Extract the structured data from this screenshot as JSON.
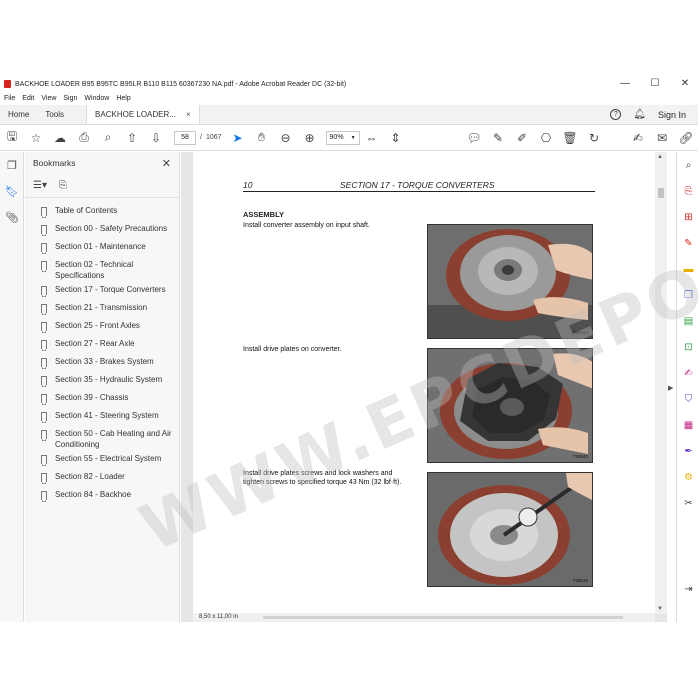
{
  "window": {
    "title": "BACKHOE LOADER B95 B95TC B95LR B110 B115 60367230 NA.pdf - Adobe Acrobat Reader DC (32-bit)",
    "controls": [
      "—",
      "☐",
      "✕"
    ]
  },
  "menubar": [
    "File",
    "Edit",
    "View",
    "Sign",
    "Window",
    "Help"
  ],
  "tabs": {
    "home": "Home",
    "tools": "Tools",
    "document": "BACKHOE LOADER...",
    "close": "×",
    "help": "?",
    "sign_in": "Sign In"
  },
  "toolbar": {
    "current_page": "58",
    "separator": "/",
    "total_pages": "1067",
    "zoom": "90%"
  },
  "bookmarks": {
    "title": "Bookmarks",
    "close": "✕",
    "items": [
      "Table of Contents",
      "Section 00 - Safety Precautions",
      "Section 01 - Maintenance",
      "Section 02 - Technical Specifications",
      "Section 17 - Torque Converters",
      "Section 21 - Transmission",
      "Section 25 - Front Axles",
      "Section 27 - Rear Axle",
      "Section 33 - Brakes System",
      "Section 35 - Hydraulic System",
      "Section 39 - Chassis",
      "Section 41 - Steering System",
      "Section 50 - Cab Heating and Air Conditioning",
      "Section 55 - Electrical System",
      "Section 82 - Loader",
      "Section 84 - Backhoe"
    ]
  },
  "document": {
    "page_number": "10",
    "section_title": "SECTION 17 - TORQUE CONVERTERS",
    "heading": "ASSEMBLY",
    "steps": [
      "Install converter assembly on input shaft.",
      "Install drive plates on converter.",
      "Install drive plates screws and lock washers and tighten screws to specified torque 43 Nm (32 lbf·ft)."
    ],
    "photo_codes": [
      "T28044",
      "T28043",
      "T28045"
    ],
    "page_size": "8,50 x 11,00 in"
  },
  "watermark": "WWW.EPCDEPO.COM",
  "colors": {
    "accent": "#1473e6",
    "pdf_red": "#d4241c"
  }
}
